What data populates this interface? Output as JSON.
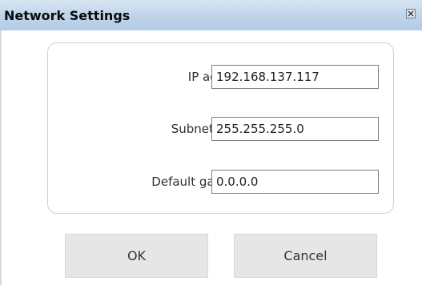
{
  "window": {
    "title": "Network Settings",
    "close_icon": "close-icon",
    "title_bar_color": "#bfd4ea"
  },
  "fields": [
    {
      "label": "IP address:",
      "value": "192.168.137.117"
    },
    {
      "label": "Subnet mask:",
      "value": "255.255.255.0"
    },
    {
      "label": "Default gateway:",
      "value": "0.0.0.0"
    }
  ],
  "buttons": {
    "ok_label": "OK",
    "cancel_label": "Cancel"
  }
}
